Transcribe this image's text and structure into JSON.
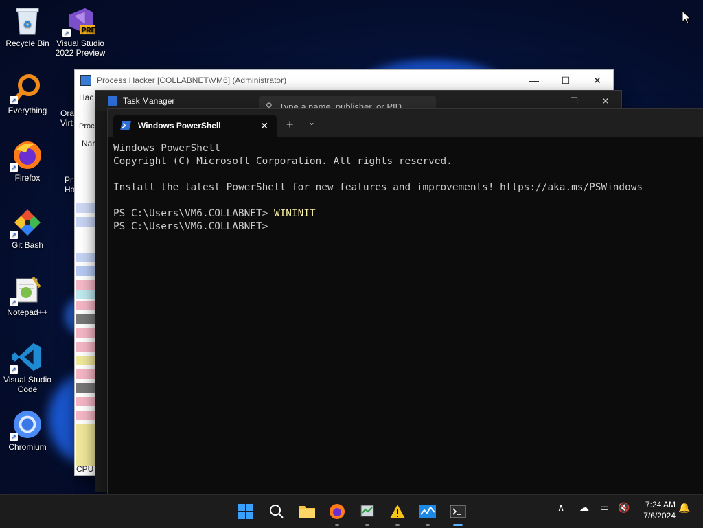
{
  "desktop": {
    "icons": [
      {
        "label": "Recycle Bin"
      },
      {
        "label": "Visual Studio 2022 Preview",
        "badge": "PRE"
      },
      {
        "label": "Everything"
      },
      {
        "label": "Firefox"
      },
      {
        "label": "Git Bash"
      },
      {
        "label": "Notepad++"
      },
      {
        "label": "Visual Studio Code"
      },
      {
        "label": "Chromium"
      }
    ],
    "partial_labels": {
      "oracle": "Ora\nVirt",
      "ph": "Pr\nHa"
    }
  },
  "process_hacker": {
    "title": "Process Hacker [COLLABNET\\VM6] (Administrator)",
    "menu_partial": "Hac",
    "tab_partial": "Proc",
    "col_partial": "Nar",
    "status_partial": "CPU"
  },
  "task_manager": {
    "title": "Task Manager",
    "search_placeholder": "Type a name, publisher, or PID"
  },
  "powershell": {
    "tab_title": "Windows PowerShell",
    "lines": {
      "l1": "Windows PowerShell",
      "l2": "Copyright (C) Microsoft Corporation. All rights reserved.",
      "l3": "",
      "l4": "Install the latest PowerShell for new features and improvements! https://aka.ms/PSWindows",
      "l5": "",
      "prompt1": "PS C:\\Users\\VM6.COLLABNET> ",
      "cmd1": "WININIT",
      "prompt2": "PS C:\\Users\\VM6.COLLABNET> "
    }
  },
  "taskbar": {
    "time": "7:24 AM",
    "date": "7/6/2024"
  },
  "colors": {
    "accent": "#0078d4",
    "console_bg": "#0c0c0c",
    "console_fg": "#cccccc",
    "cmd_fg": "#f9f1a5"
  }
}
